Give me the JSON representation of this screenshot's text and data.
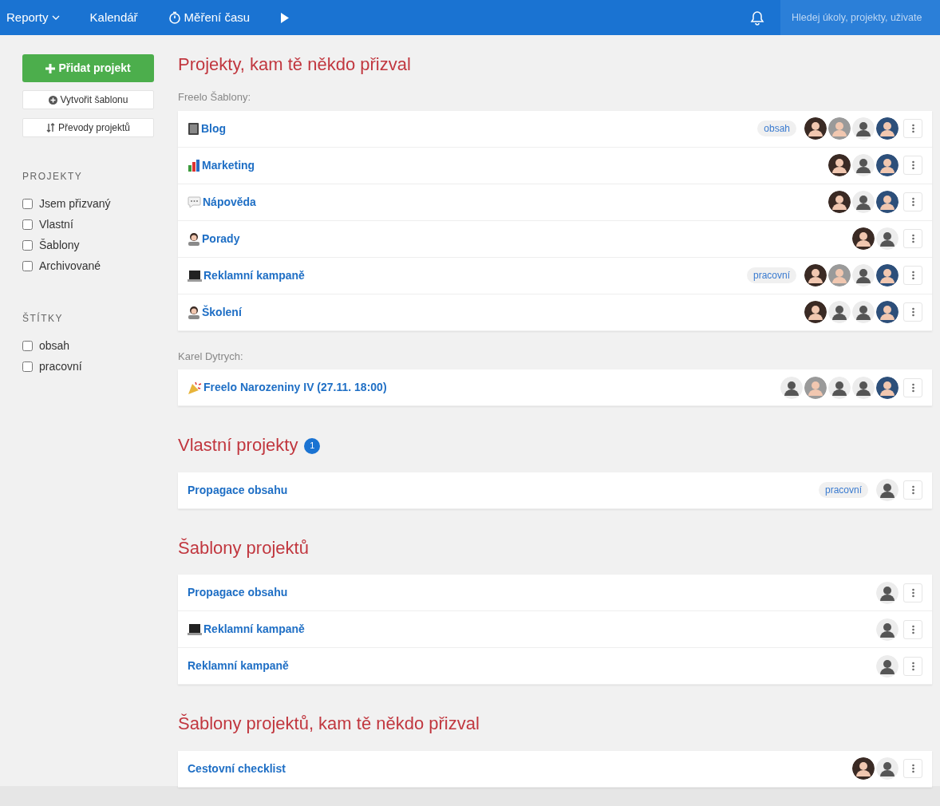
{
  "nav": {
    "items": [
      {
        "kind": "dropdown",
        "label": "Reporty"
      },
      {
        "kind": "link",
        "label": "Kalendář"
      },
      {
        "kind": "timer",
        "label": "Měření času"
      },
      {
        "kind": "play"
      }
    ],
    "search": {
      "placeholder": "Hledej úkoly, projekty, uživate"
    }
  },
  "sidebar": {
    "add_button": "Přidat projekt",
    "template_button": "Vytvořit šablonu",
    "transfer_button": "Převody projektů",
    "filter_groups": [
      {
        "title": "PROJEKTY",
        "items": [
          {
            "label": "Jsem přizvaný",
            "checked": false
          },
          {
            "label": "Vlastní",
            "checked": false
          },
          {
            "label": "Šablony",
            "checked": false
          },
          {
            "label": "Archivované",
            "checked": false
          }
        ]
      },
      {
        "title": "ŠTÍTKY",
        "items": [
          {
            "label": "obsah",
            "checked": false
          },
          {
            "label": "pracovní",
            "checked": false
          }
        ]
      }
    ]
  },
  "sections": [
    {
      "title": "Projekty, kam tě někdo přizval",
      "groups": [
        {
          "owner": "Freelo Šablony:",
          "projects": [
            {
              "name": "Blog",
              "kind": "book",
              "tag": "obsah",
              "avatars": [
                {
                  "kind": "dark"
                },
                {
                  "kind": "grey"
                },
                {
                  "kind": "light"
                },
                {
                  "kind": "blue"
                }
              ]
            },
            {
              "name": "Marketing",
              "kind": "chart",
              "avatars": [
                {
                  "kind": "dark"
                },
                {
                  "kind": "light"
                },
                {
                  "kind": "blue"
                }
              ]
            },
            {
              "name": "Nápověda",
              "kind": "speech",
              "avatars": [
                {
                  "kind": "dark"
                },
                {
                  "kind": "light"
                },
                {
                  "kind": "blue"
                }
              ]
            },
            {
              "name": "Porady",
              "kind": "person",
              "avatars": [
                {
                  "kind": "dark"
                },
                {
                  "kind": "light"
                }
              ]
            },
            {
              "name": "Reklamní kampaně",
              "kind": "laptop",
              "tag": "pracovní",
              "avatars": [
                {
                  "kind": "dark"
                },
                {
                  "kind": "grey"
                },
                {
                  "kind": "light"
                },
                {
                  "kind": "blue"
                }
              ]
            },
            {
              "name": "Školení",
              "kind": "person",
              "avatars": [
                {
                  "kind": "dark"
                },
                {
                  "kind": "light"
                },
                {
                  "kind": "light"
                },
                {
                  "kind": "blue"
                }
              ]
            }
          ]
        },
        {
          "owner": "Karel Dytrych:",
          "projects": [
            {
              "name": "Freelo Narozeniny IV (27.11. 18:00)",
              "kind": "party",
              "avatars": [
                {
                  "kind": "light"
                },
                {
                  "kind": "grey"
                },
                {
                  "kind": "light"
                },
                {
                  "kind": "light"
                },
                {
                  "kind": "blue"
                }
              ]
            }
          ]
        }
      ]
    },
    {
      "title": "Vlastní projekty",
      "badge": "1",
      "groups": [
        {
          "projects": [
            {
              "name": "Propagace obsahu",
              "kind": "plain",
              "tag": "pracovní",
              "avatars": [
                {
                  "kind": "light"
                }
              ]
            }
          ]
        }
      ]
    },
    {
      "title": "Šablony projektů",
      "groups": [
        {
          "projects": [
            {
              "name": "Propagace obsahu",
              "kind": "plain",
              "avatars": [
                {
                  "kind": "light"
                }
              ]
            },
            {
              "name": "Reklamní kampaně",
              "kind": "laptop",
              "avatars": [
                {
                  "kind": "light"
                }
              ]
            },
            {
              "name": "Reklamní kampaně",
              "kind": "plain",
              "avatars": [
                {
                  "kind": "light"
                }
              ]
            }
          ]
        }
      ]
    },
    {
      "title": "Šablony projektů, kam tě někdo přizval",
      "groups": [
        {
          "projects": [
            {
              "name": "Cestovní checklist",
              "kind": "plain",
              "avatars": [
                {
                  "kind": "dark"
                },
                {
                  "kind": "light"
                }
              ]
            }
          ]
        }
      ]
    }
  ]
}
